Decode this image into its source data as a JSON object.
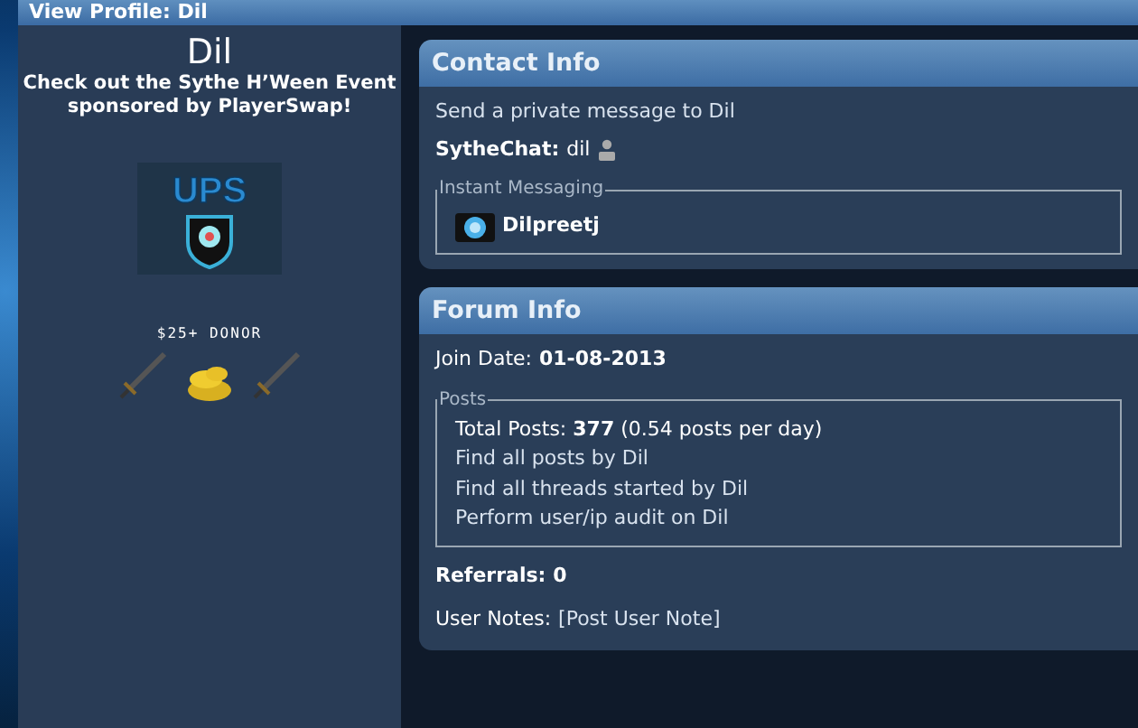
{
  "page_title": "View Profile: Dil",
  "profile": {
    "username": "Dil",
    "tagline": "Check out the Sythe H’Ween Event sponsored by PlayerSwap!",
    "logo_text": "UPS",
    "donor_label": "$25+ DONOR"
  },
  "contact_info": {
    "title": "Contact Info",
    "pm_link": "Send a private message to Dil",
    "chat_label": "SytheChat:",
    "chat_value": "dil",
    "im_legend": "Instant Messaging",
    "im_accounts": [
      {
        "name": "Dilpreetj"
      }
    ]
  },
  "forum_info": {
    "title": "Forum Info",
    "join_label": "Join Date:",
    "join_value": "01-08-2013",
    "posts_legend": "Posts",
    "total_posts": "Total Posts: **377** (0.54 posts per day)",
    "post_links": [
      "Find all posts by Dil",
      "Find all threads started by Dil",
      "Perform user/ip audit on Dil"
    ],
    "referrals_label": "Referrals:",
    "referrals_value": "0",
    "notes_label": "User Notes:",
    "notes_link": "[Post User Note]"
  }
}
